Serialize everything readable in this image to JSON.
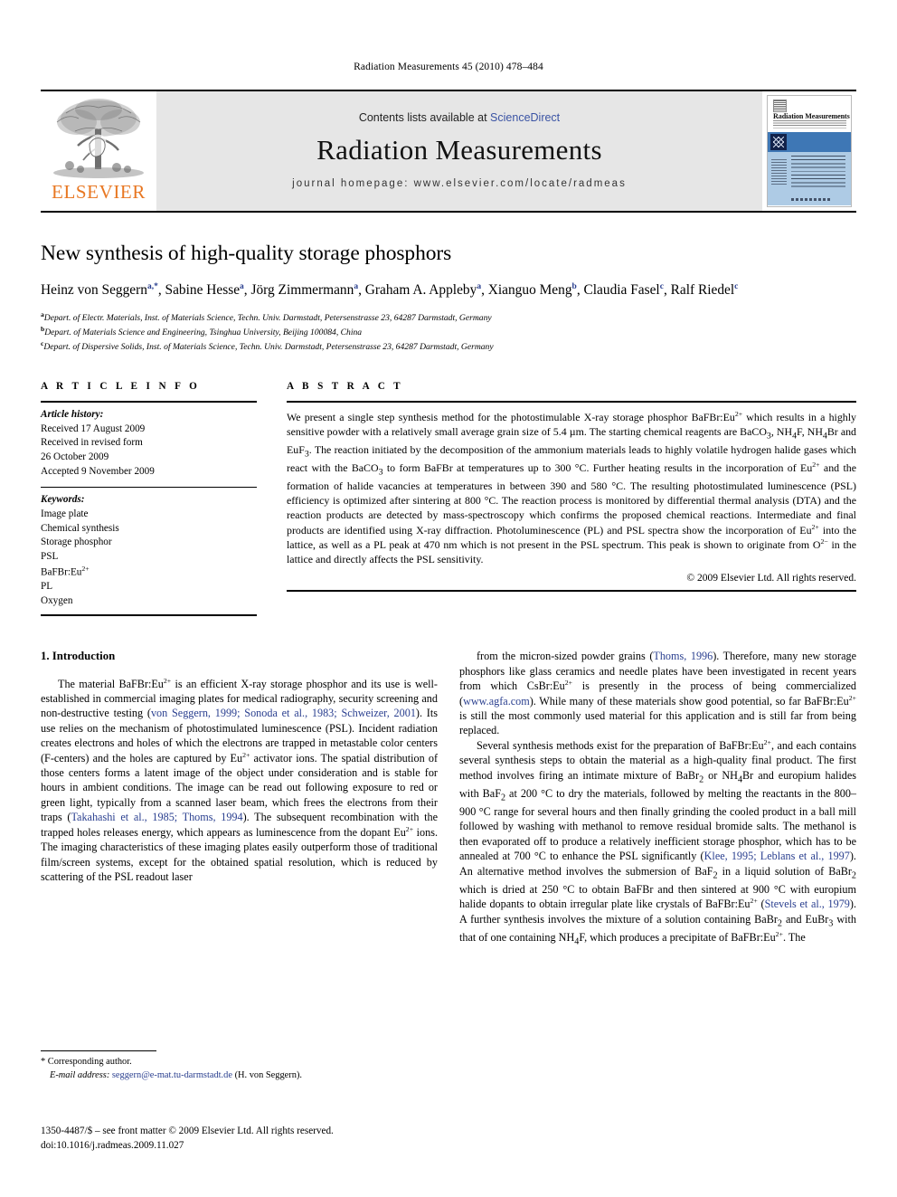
{
  "running_head": "Radiation Measurements 45 (2010) 478–484",
  "masthead": {
    "publisher_wordmark": "ELSEVIER",
    "contents_prefix": "Contents lists available at",
    "sciencedirect": "ScienceDirect",
    "journal_title": "Radiation Measurements",
    "homepage": "journal homepage: www.elsevier.com/locate/radmeas",
    "cover_title": "Radiation Measurements",
    "accent_orange": "#E87722",
    "link_blue": "#3a53a4",
    "band_blue": "#3e77b5",
    "cover_body_blue": "#aecbe5"
  },
  "article": {
    "title": "New synthesis of high-quality storage phosphors",
    "authors": [
      {
        "name": "Heinz von Seggern",
        "marks": "a,*"
      },
      {
        "name": "Sabine Hesse",
        "marks": "a"
      },
      {
        "name": "Jörg Zimmermann",
        "marks": "a"
      },
      {
        "name": "Graham A. Appleby",
        "marks": "a"
      },
      {
        "name": "Xianguo Meng",
        "marks": "b"
      },
      {
        "name": "Claudia Fasel",
        "marks": "c"
      },
      {
        "name": "Ralf Riedel",
        "marks": "c"
      }
    ],
    "affiliations": [
      {
        "mark": "a",
        "text": "Depart. of Electr. Materials, Inst. of Materials Science, Techn. Univ. Darmstadt, Petersenstrasse 23, 64287 Darmstadt, Germany"
      },
      {
        "mark": "b",
        "text": "Depart. of Materials Science and Engineering, Tsinghua University, Beijing 100084, China"
      },
      {
        "mark": "c",
        "text": "Depart. of Dispersive Solids, Inst. of Materials Science, Techn. Univ. Darmstadt, Petersenstrasse 23, 64287 Darmstadt, Germany"
      }
    ]
  },
  "article_info": {
    "heading": "A R T I C L E  I N F O",
    "history_label": "Article history:",
    "history": [
      "Received 17 August 2009",
      "Received in revised form",
      "26 October 2009",
      "Accepted 9 November 2009"
    ],
    "keywords_label": "Keywords:",
    "keywords": [
      "Image plate",
      "Chemical synthesis",
      "Storage phosphor",
      "PSL",
      "BaFBr:Eu2+",
      "PL",
      "Oxygen"
    ]
  },
  "abstract": {
    "heading": "A B S T R A C T",
    "text": "We present a single step synthesis method for the photostimulable X-ray storage phosphor BaFBr:Eu2+ which results in a highly sensitive powder with a relatively small average grain size of 5.4 µm. The starting chemical reagents are BaCO3, NH4F, NH4Br and EuF3. The reaction initiated by the decomposition of the ammonium materials leads to highly volatile hydrogen halide gases which react with the BaCO3 to form BaFBr at temperatures up to 300 °C. Further heating results in the incorporation of Eu2+ and the formation of halide vacancies at temperatures in between 390 and 580 °C. The resulting photostimulated luminescence (PSL) efficiency is optimized after sintering at 800 °C. The reaction process is monitored by differential thermal analysis (DTA) and the reaction products are detected by mass-spectroscopy which confirms the proposed chemical reactions. Intermediate and final products are identified using X-ray diffraction. Photoluminescence (PL) and PSL spectra show the incorporation of Eu2+ into the lattice, as well as a PL peak at 470 nm which is not present in the PSL spectrum. This peak is shown to originate from O2− in the lattice and directly affects the PSL sensitivity.",
    "copyright": "© 2009 Elsevier Ltd. All rights reserved."
  },
  "introduction": {
    "heading": "1. Introduction",
    "left_paragraph": "The material BaFBr:Eu2+ is an efficient X-ray storage phosphor and its use is well-established in commercial imaging plates for medical radiography, security screening and non-destructive testing (von Seggern, 1999; Sonoda et al., 1983; Schweizer, 2001). Its use relies on the mechanism of photostimulated luminescence (PSL). Incident radiation creates electrons and holes of which the electrons are trapped in metastable color centers (F-centers) and the holes are captured by Eu2+ activator ions. The spatial distribution of those centers forms a latent image of the object under consideration and is stable for hours in ambient conditions. The image can be read out following exposure to red or green light, typically from a scanned laser beam, which frees the electrons from their traps (Takahashi et al., 1985; Thoms, 1994). The subsequent recombination with the trapped holes releases energy, which appears as luminescence from the dopant Eu2+ ions. The imaging characteristics of these imaging plates easily outperform those of traditional film/screen systems, except for the obtained spatial resolution, which is reduced by scattering of the PSL readout laser",
    "right_paragraph_1": "from the micron-sized powder grains (Thoms, 1996). Therefore, many new storage phosphors like glass ceramics and needle plates have been investigated in recent years from which CsBr:Eu2+ is presently in the process of being commercialized (www.agfa.com). While many of these materials show good potential, so far BaFBr:Eu2+ is still the most commonly used material for this application and is still far from being replaced.",
    "right_paragraph_2": "Several synthesis methods exist for the preparation of BaFBr:Eu2+, and each contains several synthesis steps to obtain the material as a high-quality final product. The first method involves firing an intimate mixture of BaBr2 or NH4Br and europium halides with BaF2 at 200 °C to dry the materials, followed by melting the reactants in the 800–900 °C range for several hours and then finally grinding the cooled product in a ball mill followed by washing with methanol to remove residual bromide salts. The methanol is then evaporated off to produce a relatively inefficient storage phosphor, which has to be annealed at 700 °C to enhance the PSL significantly (Klee, 1995; Leblans et al., 1997). An alternative method involves the submersion of BaF2 in a liquid solution of BaBr2 which is dried at 250 °C to obtain BaFBr and then sintered at 900 °C with europium halide dopants to obtain irregular plate like crystals of BaFBr:Eu2+ (Stevels et al., 1979). A further synthesis involves the mixture of a solution containing BaBr2 and EuBr3 with that of one containing NH4F, which produces a precipitate of BaFBr:Eu2+. The",
    "citations_left": [
      "von Seggern, 1999; Sonoda et al., 1983; Schweizer, 2001",
      "Takahashi et al., 1985; Thoms, 1994"
    ],
    "citations_right": [
      "Thoms, 1996",
      "www.agfa.com",
      "Klee, 1995; Leblans et al., 1997",
      "Stevels et al., 1979"
    ]
  },
  "footnote": {
    "corresponding": "* Corresponding author.",
    "email_label": "E-mail address:",
    "email": "seggern@e-mat.tu-darmstadt.de",
    "email_owner": "(H. von Seggern)."
  },
  "footer": {
    "issn_line": "1350-4487/$ – see front matter © 2009 Elsevier Ltd. All rights reserved.",
    "doi_line": "doi:10.1016/j.radmeas.2009.11.027"
  }
}
